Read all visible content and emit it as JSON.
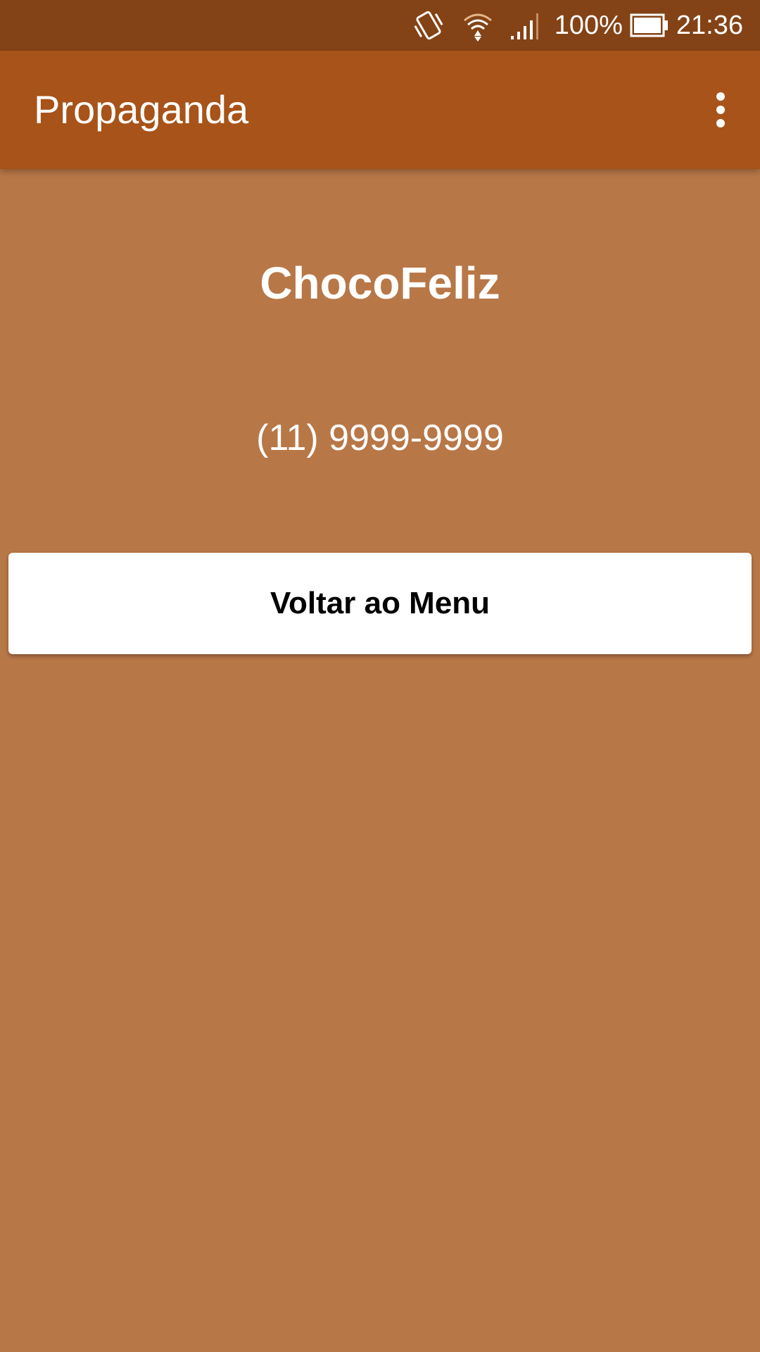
{
  "status_bar": {
    "icons": [
      "vibrate-icon",
      "wifi-icon",
      "signal-icon",
      "battery-icon"
    ],
    "battery_percent": "100%",
    "battery_level": 1.0,
    "time": "21:36"
  },
  "app_bar": {
    "title": "Propaganda",
    "menu_icon": "more-vert-icon"
  },
  "content": {
    "brand_name": "ChocoFeliz",
    "phone": "(11) 9999-9999",
    "back_button_label": "Voltar ao Menu"
  },
  "colors": {
    "status_bar": "#844316",
    "app_bar": "#A75319",
    "background": "#B87747",
    "button": "#FFFFFF",
    "text_light": "#FFFFFF",
    "button_text": "#000000"
  }
}
